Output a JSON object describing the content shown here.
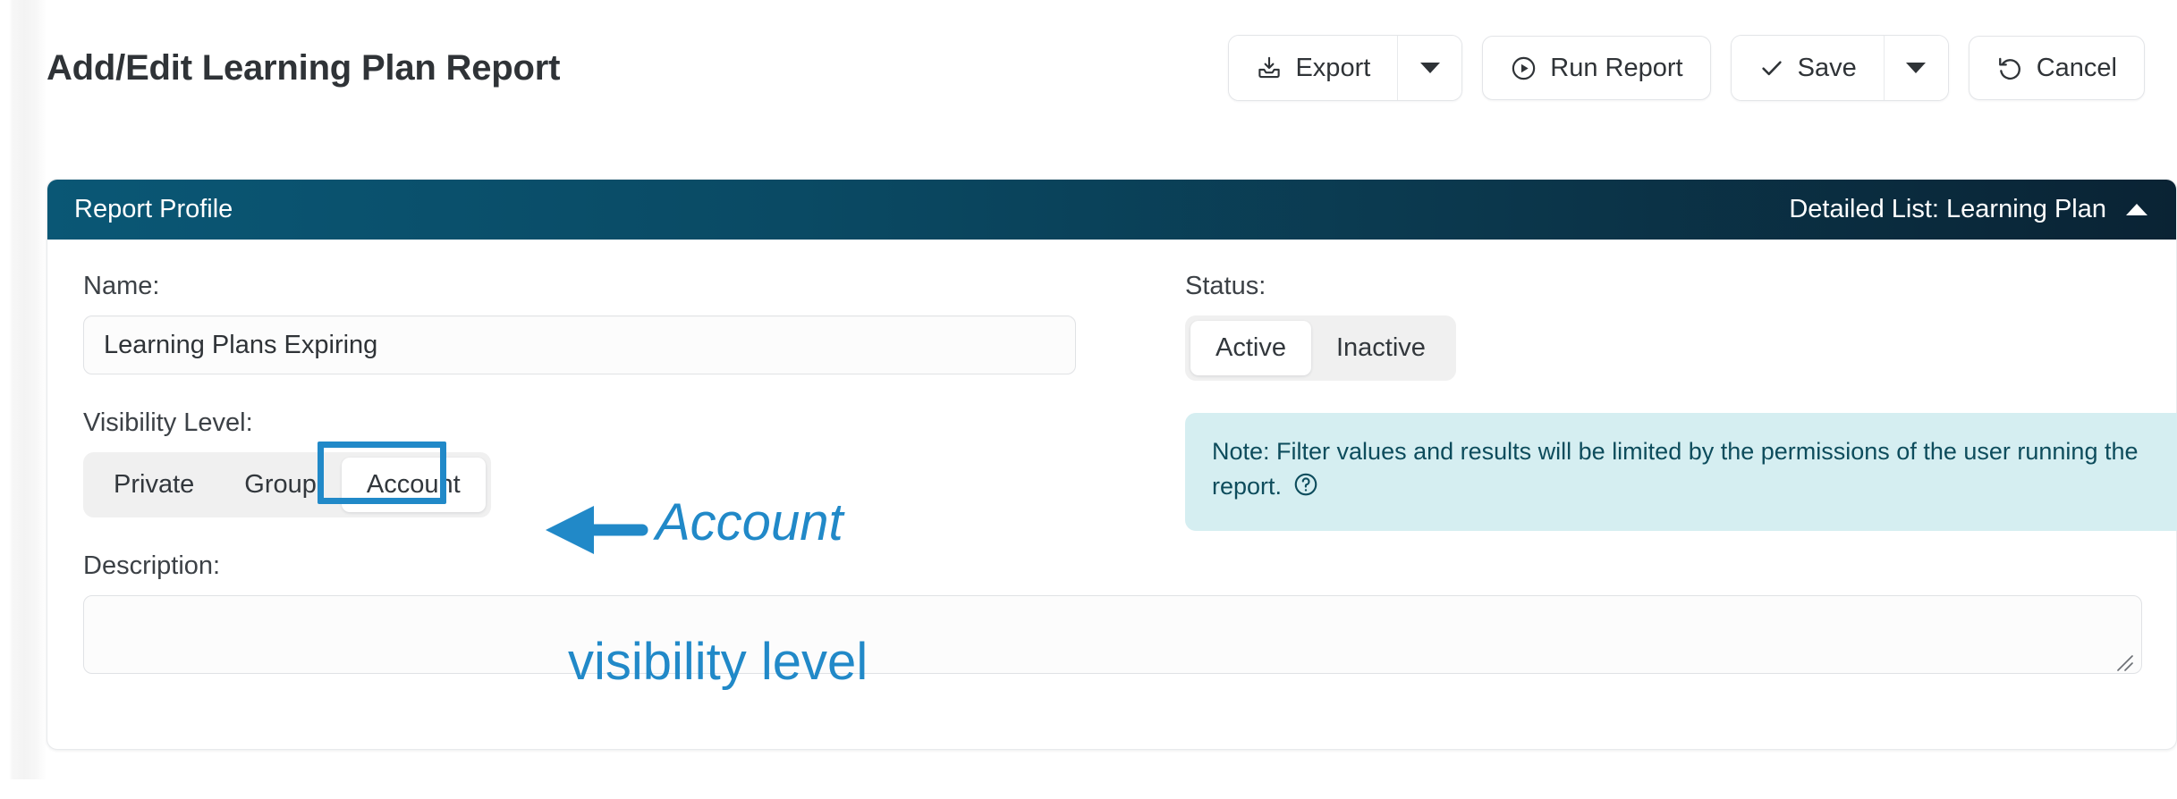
{
  "page": {
    "title": "Add/Edit Learning Plan Report"
  },
  "toolbar": {
    "export_label": "Export",
    "export_icon": "download-tray-icon",
    "export_caret_icon": "chevron-down-icon",
    "run_report_label": "Run Report",
    "run_report_icon": "play-circle-icon",
    "save_label": "Save",
    "save_icon": "check-icon",
    "save_caret_icon": "chevron-down-icon",
    "cancel_label": "Cancel",
    "cancel_icon": "undo-arrow-icon"
  },
  "card": {
    "header_title": "Report Profile",
    "header_subtitle": "Detailed List: Learning Plan",
    "collapse_icon": "chevron-up-icon"
  },
  "form": {
    "name": {
      "label": "Name:",
      "value": "Learning Plans Expiring",
      "placeholder": ""
    },
    "status": {
      "label": "Status:",
      "options": [
        "Active",
        "Inactive"
      ],
      "selected": "Active"
    },
    "visibility": {
      "label": "Visibility Level:",
      "options": [
        "Private",
        "Group",
        "Account"
      ],
      "selected": "Account"
    },
    "description": {
      "label": "Description:",
      "value": "",
      "placeholder": ""
    },
    "note": {
      "text": "Note: Filter values and results will be limited by the permissions of the user running the report.",
      "help_icon": "help-circle-icon"
    }
  },
  "annotation": {
    "line1": "Account",
    "line2": "visibility level",
    "arrow_icon": "left-arrow-icon",
    "color": "#2189c8",
    "highlight_target": "Account"
  },
  "colors": {
    "accent_blue": "#2189c8",
    "header_gradient_start": "#0a5775",
    "header_gradient_end": "#0a2334",
    "note_background": "#d5eef1",
    "note_text": "#0d4c5c",
    "segmented_track": "#f0f0f0"
  }
}
